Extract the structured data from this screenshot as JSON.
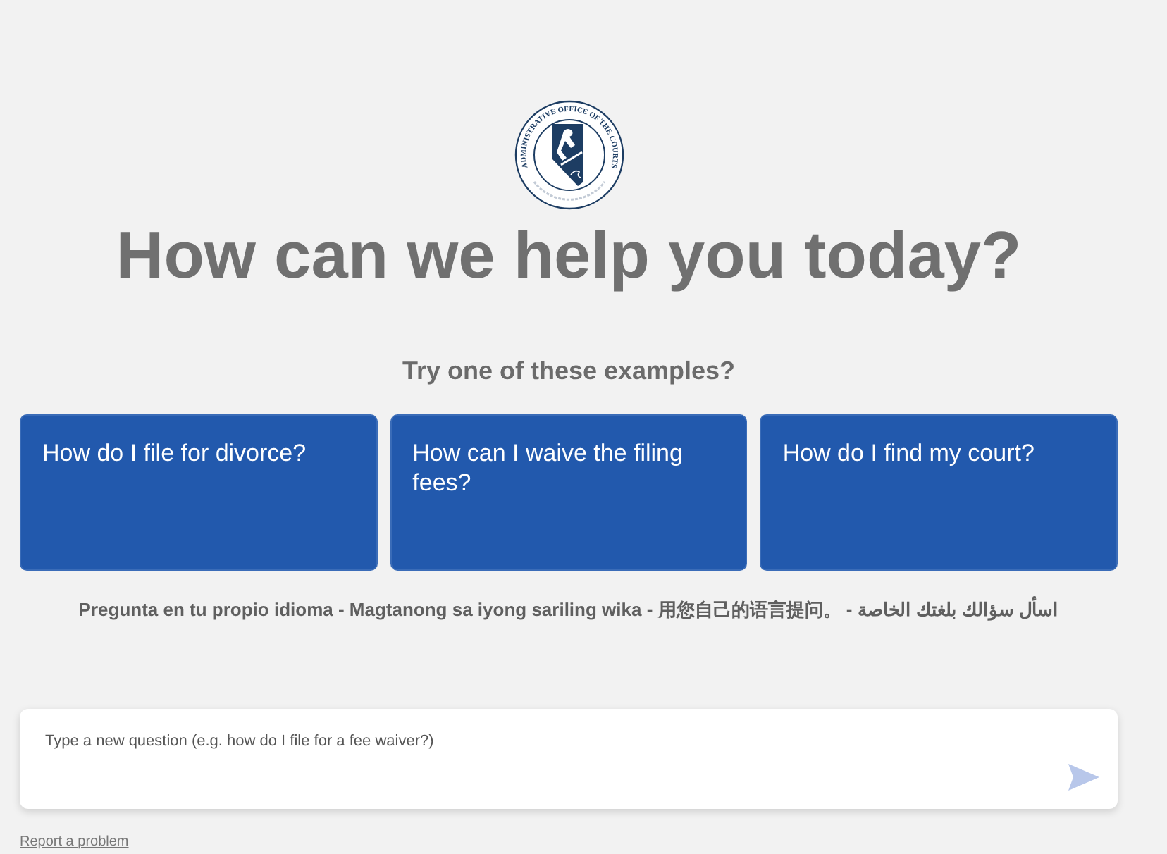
{
  "logo": {
    "seal_text": "ADMINISTRATIVE OFFICE OF THE COURTS"
  },
  "heading": "How can we help you today?",
  "examples_title": "Try one of these examples?",
  "examples": [
    {
      "label": "How do I file for divorce?"
    },
    {
      "label": "How can I waive the filing fees?"
    },
    {
      "label": "How do I find my court?"
    }
  ],
  "languages_note": "Pregunta en tu propio idioma - Magtanong sa iyong sariling wika - 用您自己的语言提问。 - اسأل سؤالك بلغتك الخاصة",
  "question_input": {
    "placeholder": "Type a new question (e.g. how do I file for a fee waiver?)"
  },
  "send_button": {
    "disabled": true
  },
  "footer_link": "Report a problem"
}
